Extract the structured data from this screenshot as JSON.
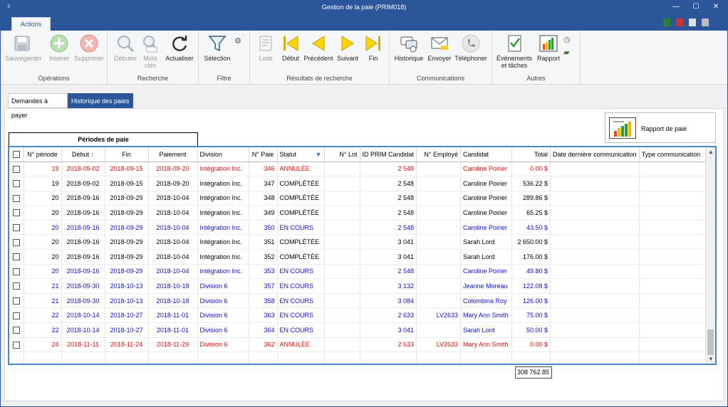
{
  "window": {
    "title": "Gestion de la paie (PRIM018)",
    "minimize": "—",
    "maximize": "☐",
    "close": "✕"
  },
  "menu": {
    "actions_tab": "Actions"
  },
  "ribbon": {
    "groups": {
      "operations": "Opérations",
      "recherche": "Recherche",
      "filtre": "Filtre",
      "resultats": "Résultats de recherche",
      "communications": "Communications",
      "autres": "Autres"
    },
    "buttons": {
      "sauvegarder": "Sauvegarder",
      "inserer": "Insérer",
      "supprimer": "Supprimer",
      "debuter": "Débuter",
      "mots_cles_1": "Mots",
      "mots_cles_2": "clés",
      "actualiser": "Actualiser",
      "selection": "Sélection",
      "liste": "Liste",
      "debut": "Début",
      "precedent": "Précédent",
      "suivant": "Suivant",
      "fin": "Fin",
      "historique": "Historique",
      "envoyer": "Envoyer",
      "telephoner": "Téléphoner",
      "evenements_1": "Événements",
      "evenements_2": "et tâches",
      "rapport": "Rapport"
    }
  },
  "tabs": {
    "demandes": "Demandes à payer",
    "historique": "Historique des paies"
  },
  "rapport_paie_button": "Rapport de paie",
  "periods_header": "Périodes de paie",
  "columns": [
    "N° période",
    "Début",
    "Fin",
    "Paiement",
    "Division",
    "N° Paie",
    "Statut",
    "N° Lot",
    "ID PRIM Candidat",
    "N° Employé",
    "Candidat",
    "Total",
    "Date dernière communication",
    "Type communication"
  ],
  "rows": [
    {
      "style": "red",
      "periode": "19",
      "debut": "2018-09-02",
      "fin": "2018-09-15",
      "paiement": "2018-09-20",
      "division": "Intégration Inc.",
      "paie": "346",
      "statut": "ANNULÉE",
      "lot": "",
      "idprim": "2 548",
      "employe": "",
      "candidat": "Caroline Poirier",
      "total": "0.00 $"
    },
    {
      "style": "black",
      "periode": "19",
      "debut": "2018-09-02",
      "fin": "2018-09-15",
      "paiement": "2018-09-20",
      "division": "Intégration Inc.",
      "paie": "347",
      "statut": "COMPLÉTÉE",
      "lot": "",
      "idprim": "2 548",
      "employe": "",
      "candidat": "Caroline Poirier",
      "total": "536.22 $"
    },
    {
      "style": "black",
      "periode": "20",
      "debut": "2018-09-16",
      "fin": "2018-09-29",
      "paiement": "2018-10-04",
      "division": "Intégration Inc.",
      "paie": "348",
      "statut": "COMPLÉTÉE",
      "lot": "",
      "idprim": "2 548",
      "employe": "",
      "candidat": "Caroline Poirier",
      "total": "289.86 $"
    },
    {
      "style": "black",
      "periode": "20",
      "debut": "2018-09-16",
      "fin": "2018-09-29",
      "paiement": "2018-10-04",
      "division": "Intégration Inc.",
      "paie": "349",
      "statut": "COMPLÉTÉE",
      "lot": "",
      "idprim": "2 548",
      "employe": "",
      "candidat": "Caroline Poirier",
      "total": "65.25 $"
    },
    {
      "style": "blue",
      "periode": "20",
      "debut": "2018-09-16",
      "fin": "2018-09-29",
      "paiement": "2018-10-04",
      "division": "Intégration Inc.",
      "paie": "350",
      "statut": "EN COURS",
      "lot": "",
      "idprim": "2 548",
      "employe": "",
      "candidat": "Caroline Poirier",
      "total": "43.50 $"
    },
    {
      "style": "black",
      "periode": "20",
      "debut": "2018-09-16",
      "fin": "2018-09-29",
      "paiement": "2018-10-04",
      "division": "Intégration Inc.",
      "paie": "351",
      "statut": "COMPLÉTÉE",
      "lot": "",
      "idprim": "3 041",
      "employe": "",
      "candidat": "Sarah Lord",
      "total": "2 650.00 $"
    },
    {
      "style": "black",
      "periode": "20",
      "debut": "2018-09-16",
      "fin": "2018-09-29",
      "paiement": "2018-10-04",
      "division": "Intégration Inc.",
      "paie": "352",
      "statut": "COMPLÉTÉE",
      "lot": "",
      "idprim": "3 041",
      "employe": "",
      "candidat": "Sarah Lord",
      "total": "176.00 $"
    },
    {
      "style": "blue",
      "periode": "20",
      "debut": "2018-09-16",
      "fin": "2018-09-29",
      "paiement": "2018-10-04",
      "division": "Intégration Inc.",
      "paie": "353",
      "statut": "EN COURS",
      "lot": "",
      "idprim": "2 548",
      "employe": "",
      "candidat": "Caroline Poirier",
      "total": "49.80 $"
    },
    {
      "style": "blue",
      "periode": "21",
      "debut": "2018-09-30",
      "fin": "2018-10-13",
      "paiement": "2018-10-18",
      "division": "Division 6",
      "paie": "357",
      "statut": "EN COURS",
      "lot": "",
      "idprim": "3 132",
      "employe": "",
      "candidat": "Jeanne Moreau",
      "total": "122.08 $"
    },
    {
      "style": "blue",
      "periode": "21",
      "debut": "2018-09-30",
      "fin": "2018-10-13",
      "paiement": "2018-10-18",
      "division": "Division 6",
      "paie": "358",
      "statut": "EN COURS",
      "lot": "",
      "idprim": "3 084",
      "employe": "",
      "candidat": "Colombina Roy",
      "total": "126.00 $"
    },
    {
      "style": "blue",
      "periode": "22",
      "debut": "2018-10-14",
      "fin": "2018-10-27",
      "paiement": "2018-11-01",
      "division": "Division 6",
      "paie": "363",
      "statut": "EN COURS",
      "lot": "",
      "idprim": "2 633",
      "employe": "LV2633",
      "candidat": "Mary Ann Smith",
      "total": "75.00 $"
    },
    {
      "style": "blue",
      "periode": "22",
      "debut": "2018-10-14",
      "fin": "2018-10-27",
      "paiement": "2018-11-01",
      "division": "Division 6",
      "paie": "364",
      "statut": "EN COURS",
      "lot": "",
      "idprim": "3 041",
      "employe": "",
      "candidat": "Sarah Lord",
      "total": "50.00 $"
    },
    {
      "style": "red",
      "periode": "24",
      "debut": "2018-11-11",
      "fin": "2018-11-24",
      "paiement": "2018-11-29",
      "division": "Division 6",
      "paie": "362",
      "statut": "ANNULÉE",
      "lot": "",
      "idprim": "2 633",
      "employe": "LV2633",
      "candidat": "Mary Ann Smith",
      "total": "0.00 $"
    }
  ],
  "grand_total": "308 762.85",
  "colors": {
    "accent": "#2b579a",
    "cancelled": "#e01010",
    "in_progress": "#1010d0",
    "grid_border": "#4a86c8"
  }
}
